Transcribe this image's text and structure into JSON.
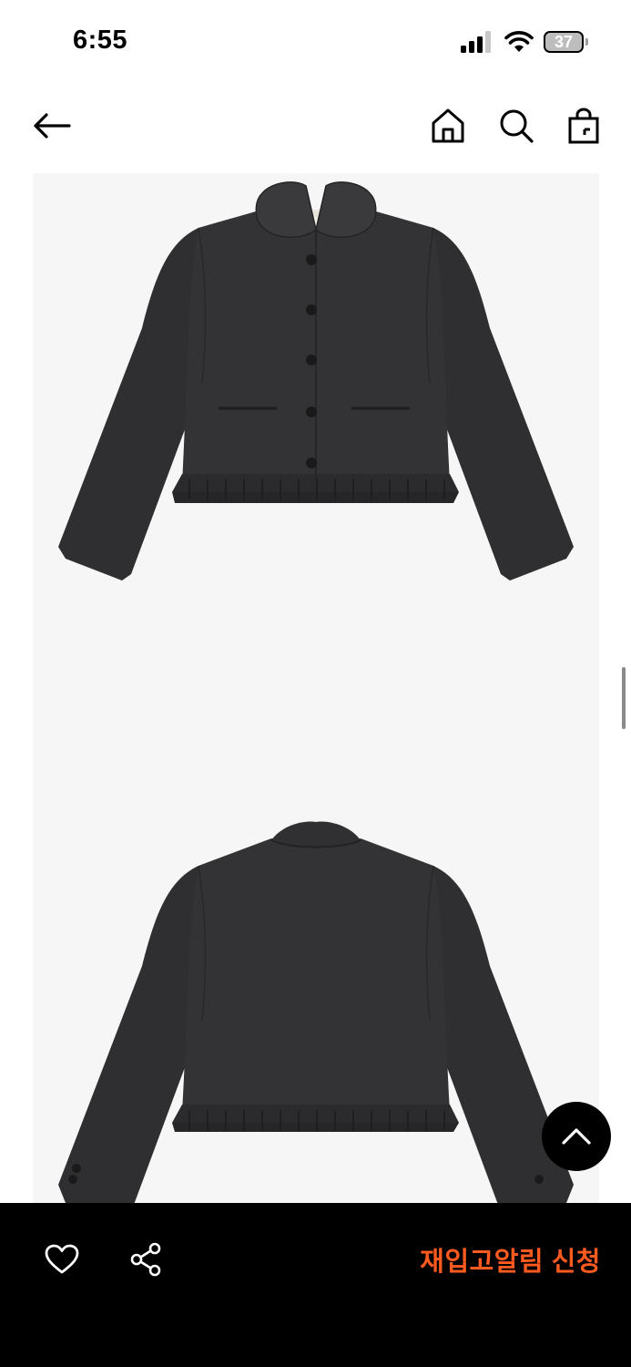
{
  "status_bar": {
    "time": "6:55",
    "battery_percent": "37",
    "icons": [
      "signal-icon",
      "wifi-icon",
      "battery-icon"
    ]
  },
  "nav": {
    "icons": [
      "back-arrow-icon",
      "home-icon",
      "search-icon",
      "shopping-bag-icon"
    ]
  },
  "gallery": {
    "images": [
      "jacket-front-image",
      "jacket-back-image"
    ]
  },
  "bottom_bar": {
    "restock_label": "재입고알림 신청",
    "icons": [
      "heart-icon",
      "share-icon"
    ]
  },
  "colors": {
    "accent": "#ff5a1f",
    "bottom_bar_bg": "#000000",
    "gallery_bg": "#f6f6f6",
    "jacket": "#2e2e30"
  }
}
